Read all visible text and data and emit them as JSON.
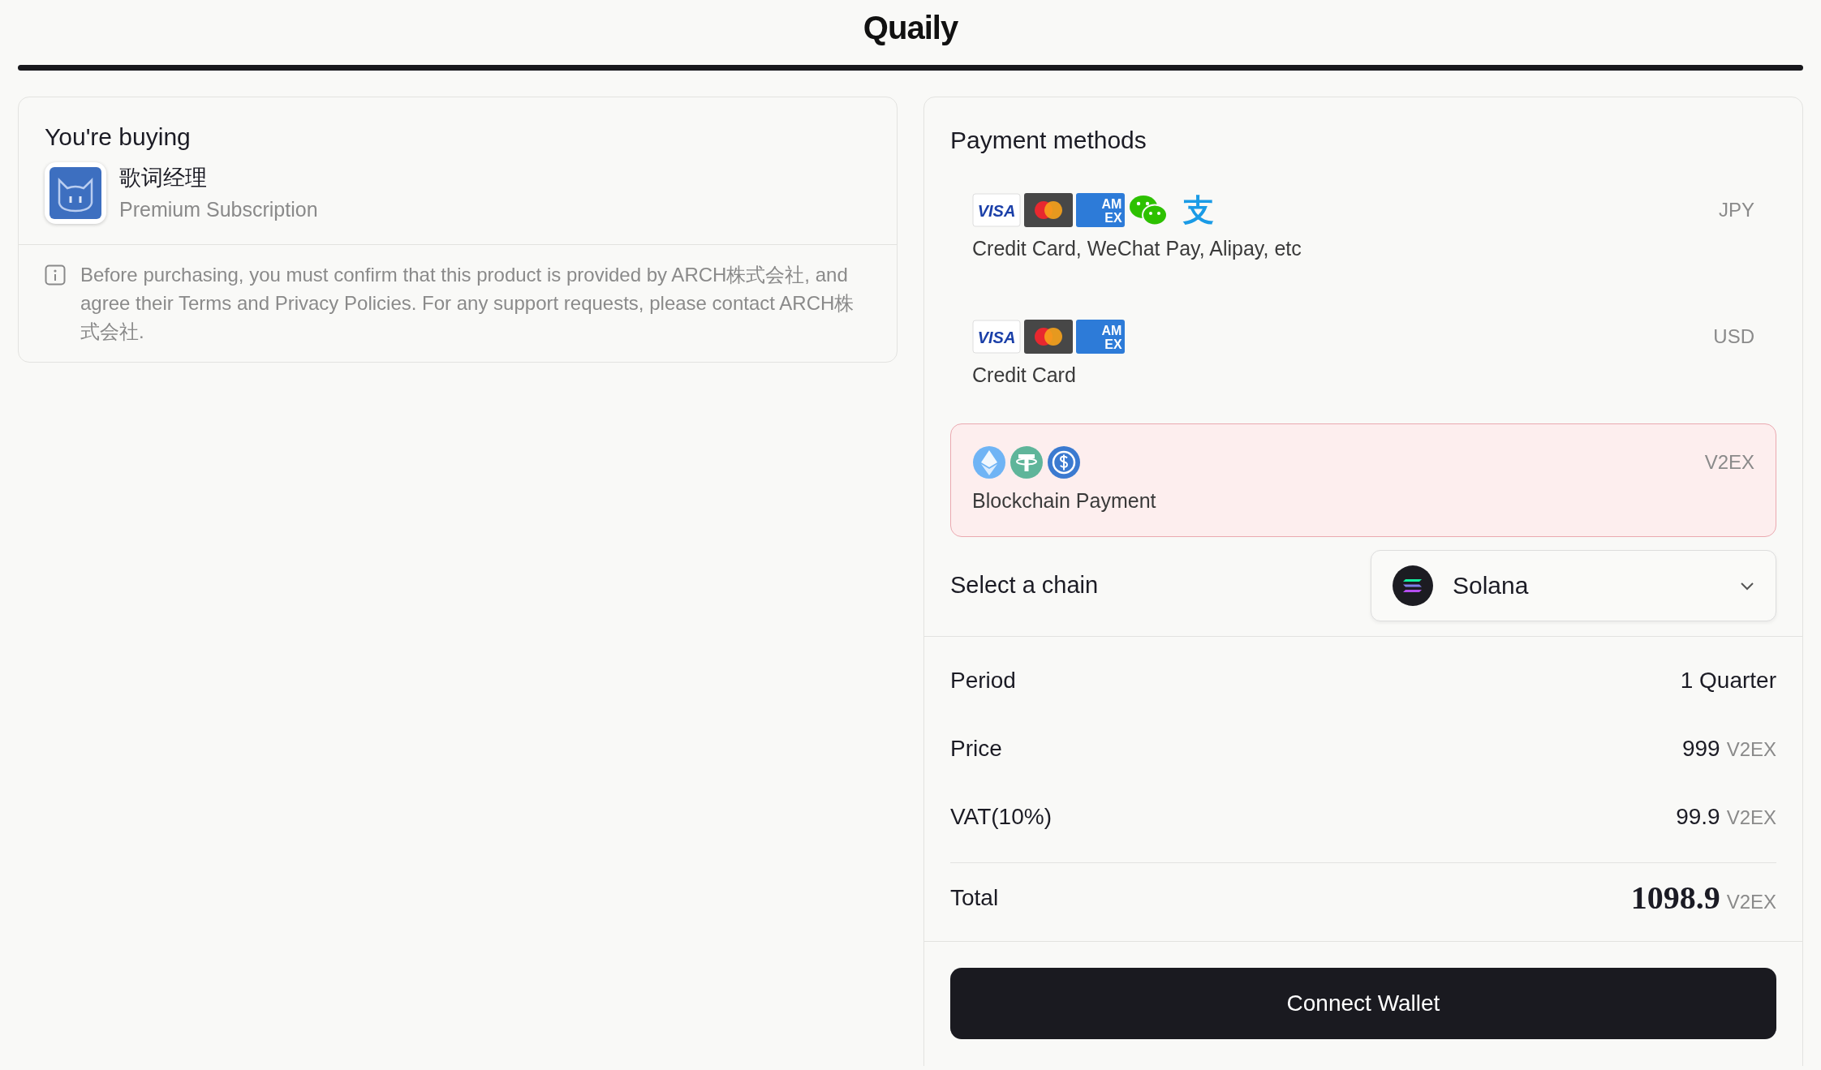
{
  "logo": "Quaily",
  "product_card": {
    "title": "You're buying",
    "product": {
      "name": "歌词经理",
      "subtitle": "Premium Subscription"
    },
    "notice": "Before purchasing, you must confirm that this product is provided by ARCH株式会社, and agree their Terms and Privacy Policies. For any support requests, please contact ARCH株式会社."
  },
  "payment": {
    "title": "Payment methods",
    "methods": [
      {
        "icons": [
          {
            "kind": "visa",
            "text": "VISA"
          },
          {
            "kind": "mastercard"
          },
          {
            "kind": "amex",
            "lines": [
              "AM",
              "EX"
            ]
          },
          {
            "kind": "wechat"
          },
          {
            "kind": "alipay",
            "text": "支"
          }
        ],
        "label": "Credit Card, WeChat Pay, Alipay, etc",
        "currency": "JPY",
        "selected": false
      },
      {
        "icons": [
          {
            "kind": "visa",
            "text": "VISA"
          },
          {
            "kind": "mastercard"
          },
          {
            "kind": "amex",
            "lines": [
              "AM",
              "EX"
            ]
          }
        ],
        "label": "Credit Card",
        "currency": "USD",
        "selected": false
      },
      {
        "icons": [
          {
            "kind": "eth"
          },
          {
            "kind": "usdt"
          },
          {
            "kind": "usdc"
          }
        ],
        "label": "Blockchain Payment",
        "currency": "V2EX",
        "selected": true
      }
    ],
    "chain": {
      "label": "Select a chain",
      "value": "Solana"
    }
  },
  "summary": [
    {
      "kind": "plain",
      "label": "Period",
      "value": "1 Quarter"
    },
    {
      "kind": "plain",
      "label": "Price",
      "value": "999",
      "unit": "V2EX"
    },
    {
      "kind": "plain",
      "label": "VAT(10%)",
      "value": "99.9",
      "unit": "V2EX"
    },
    {
      "kind": "total",
      "label": "Total",
      "value": "1098.9",
      "unit": "V2EX"
    }
  ],
  "button": "Connect Wallet"
}
